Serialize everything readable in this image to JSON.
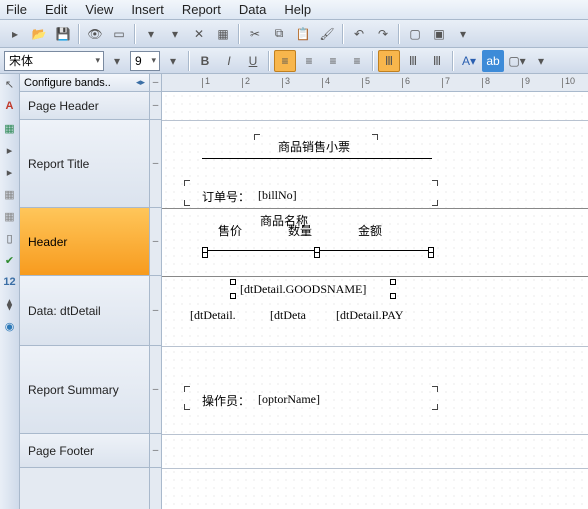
{
  "menu": {
    "items": [
      "File",
      "Edit",
      "View",
      "Insert",
      "Report",
      "Data",
      "Help"
    ]
  },
  "format": {
    "font": "宋体",
    "size": "9"
  },
  "conf": {
    "label": "Configure bands.."
  },
  "bands": {
    "b0": "Page Header",
    "b1": "Report Title",
    "b2": "Header",
    "b3": "Data: dtDetail",
    "b4": "Report Summary",
    "b5": "Page Footer"
  },
  "ruler": {
    "t1": "1",
    "t2": "2",
    "t3": "3",
    "t4": "4",
    "t5": "5",
    "t6": "6",
    "t7": "7",
    "t8": "8",
    "t9": "9",
    "t10": "10"
  },
  "fields": {
    "title": "商品销售小票",
    "orderno_lbl": "订单号：",
    "orderno_val": "[billNo]",
    "col_price": "售价",
    "col_name": "商品名称",
    "col_qty": "数量",
    "col_amt": "金额",
    "goodsname": "[dtDetail.GOODSNAME]",
    "d1": "[dtDetail.",
    "d2": "[dtDeta",
    "d3": "[dtDetail.PAY",
    "op_lbl": "操作员：",
    "op_val": "[optorName]"
  }
}
